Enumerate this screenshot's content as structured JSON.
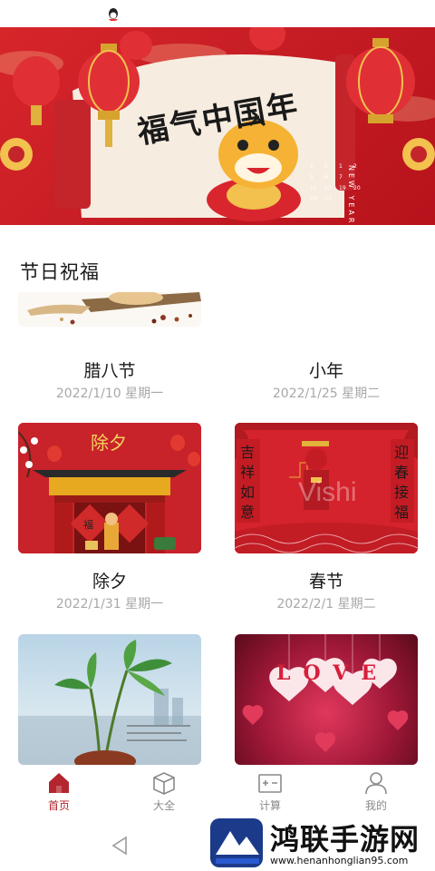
{
  "section_title": "节日祝福",
  "banner": {
    "calligraphy": "福气中国年",
    "side_text": "NEW YEAR",
    "calendar_numbers": [
      "2",
      "2",
      "1",
      "2",
      "5",
      "6",
      "7",
      "12",
      "13",
      "19",
      "20",
      "26",
      "27"
    ]
  },
  "cards": [
    {
      "name": "腊八节",
      "date": "2022/1/10 星期一"
    },
    {
      "name": "小年",
      "date": "2022/1/25 星期二"
    },
    {
      "name": "除夕",
      "date": "2022/1/31 星期一",
      "thumb_text": "除夕",
      "gate_chars": "福"
    },
    {
      "name": "春节",
      "date": "2022/2/1 星期二",
      "left_couplet": "吉祥如意",
      "right_couplet": "迎春接福",
      "overlay": "Vishi"
    },
    {
      "name": "",
      "date": ""
    },
    {
      "name": "",
      "date": "",
      "thumb_text": "LOVE"
    }
  ],
  "tabs": [
    {
      "label": "首页",
      "icon": "home-icon",
      "active": true
    },
    {
      "label": "大全",
      "icon": "box-icon",
      "active": false
    },
    {
      "label": "计算",
      "icon": "calculator-icon",
      "active": false
    },
    {
      "label": "我的",
      "icon": "user-icon",
      "active": false
    }
  ],
  "watermark": {
    "title": "鸿联手游网",
    "url": "www.henanhonglian95.com"
  },
  "colors": {
    "accent": "#b3262e",
    "banner_red": "#c71d25",
    "gold": "#f2c14e"
  }
}
